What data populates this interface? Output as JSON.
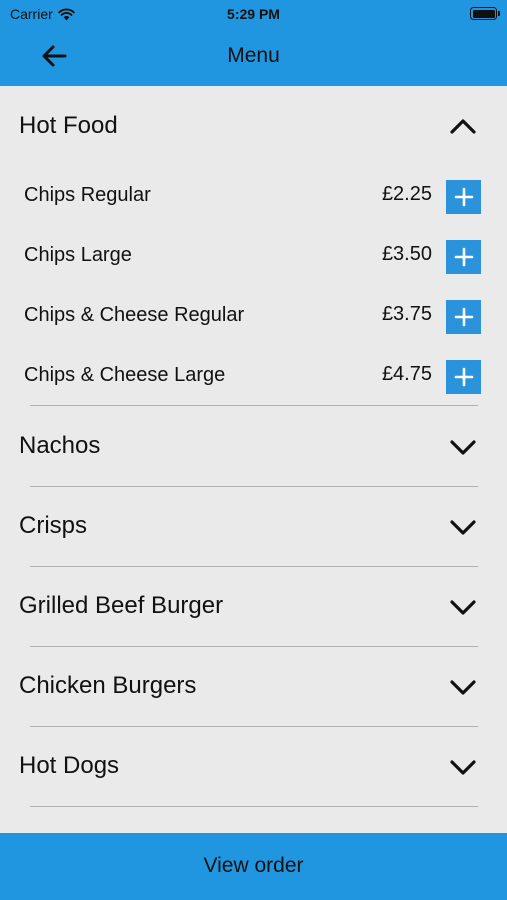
{
  "status_bar": {
    "carrier": "Carrier",
    "time": "5:29 PM"
  },
  "nav": {
    "title": "Menu"
  },
  "sections": [
    {
      "title": "Hot Food",
      "expanded": true,
      "items": [
        {
          "name": "Chips Regular",
          "price": "£2.25"
        },
        {
          "name": "Chips Large",
          "price": "£3.50"
        },
        {
          "name": "Chips & Cheese Regular",
          "price": "£3.75"
        },
        {
          "name": "Chips & Cheese Large",
          "price": "£4.75"
        }
      ]
    },
    {
      "title": "Nachos",
      "expanded": false
    },
    {
      "title": "Crisps",
      "expanded": false
    },
    {
      "title": "Grilled Beef Burger",
      "expanded": false
    },
    {
      "title": "Chicken Burgers",
      "expanded": false
    },
    {
      "title": "Hot Dogs",
      "expanded": false
    }
  ],
  "footer": {
    "button_label": "View order"
  },
  "colors": {
    "accent": "#2196e0",
    "add_button": "#2a93dc",
    "background": "#eaeaea"
  }
}
